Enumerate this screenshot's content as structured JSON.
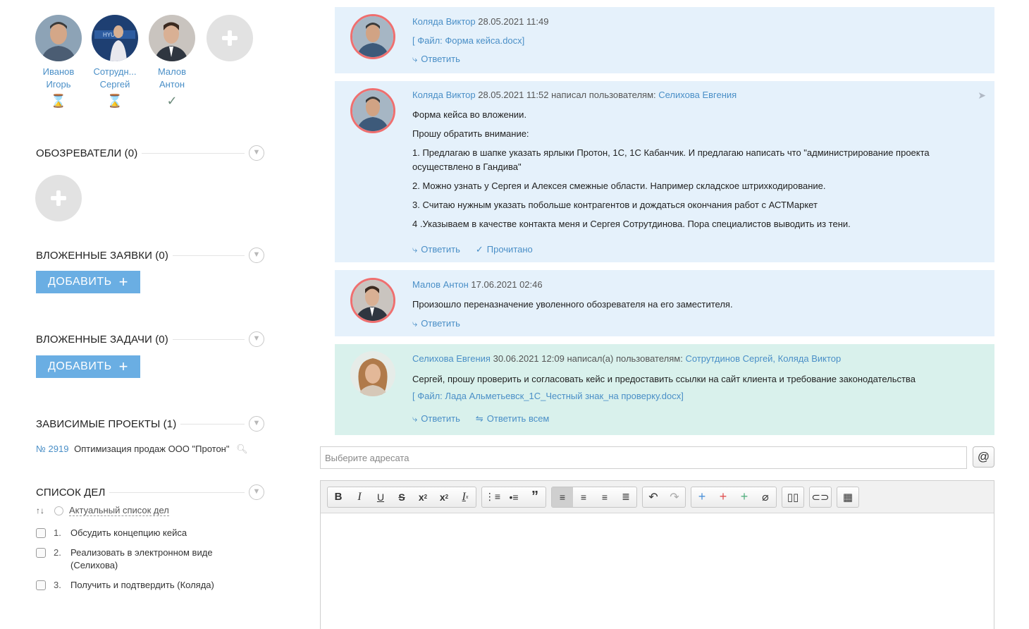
{
  "participants": [
    {
      "name_line1": "Иванов",
      "name_line2": "Игорь",
      "status_icon": "hourglass-icon"
    },
    {
      "name_line1": "Сотрудн...",
      "name_line2": "Сергей",
      "status_icon": "hourglass-icon"
    },
    {
      "name_line1": "Малов",
      "name_line2": "Антон",
      "status_icon": "checkmark-icon"
    }
  ],
  "sections": {
    "reviewers": "ОБОЗРЕВАТЕЛИ (0)",
    "nested_requests": "ВЛОЖЕННЫЕ ЗАЯВКИ (0)",
    "nested_tasks": "ВЛОЖЕННЫЕ ЗАДАЧИ (0)",
    "dependent_projects": "ЗАВИСИМЫЕ ПРОЕКТЫ (1)",
    "todo_list": "СПИСОК ДЕЛ"
  },
  "add_button_label": "ДОБАВИТЬ",
  "dependent_project": {
    "number": "№ 2919",
    "title": "Оптимизация продаж ООО \"Протон\""
  },
  "todo": {
    "sort_icon": "↑↓",
    "current_list_label": "Актуальный список дел",
    "items": [
      {
        "num": "1.",
        "text": "Обсудить концепцию кейса"
      },
      {
        "num": "2.",
        "text": "Реализовать в электронном виде (Селихова)"
      },
      {
        "num": "3.",
        "text": "Получить и подтвердить (Коляда)"
      }
    ]
  },
  "messages": [
    {
      "author": "Коляда Виктор",
      "datetime": "28.05.2021 11:49",
      "attachment": "[ Файл: Форма кейса.docx]",
      "reply": "Ответить"
    },
    {
      "author": "Коляда Виктор",
      "datetime": "28.05.2021 11:52",
      "wrote_to": "написал пользователям:",
      "recipients": "Селихова Евгения",
      "lines": [
        "Форма кейса во вложении.",
        "Прошу обратить внимание:",
        "1. Предлагаю в шапке указать ярлыки Протон, 1С, 1С Кабанчик. И предлагаю написать что \"администрирование проекта осуществлено в Гандива\"",
        "2. Можно узнать у Сергея и Алексея смежные области. Например складское штрихкодирование.",
        "3. Считаю нужным указать побольше контрагентов и дождаться окончания работ с АСТМаркет",
        "4 .Указываем в качестве контакта меня и Сергея  Сотрутдинова. Пора специалистов выводить из тени."
      ],
      "reply": "Ответить",
      "read": "Прочитано"
    },
    {
      "author": "Малов Антон",
      "datetime": "17.06.2021 02:46",
      "text": "Произошло переназначение уволенного обозревателя на его заместителя.",
      "reply": "Ответить"
    },
    {
      "author": "Селихова Евгения",
      "datetime": "30.06.2021 12:09",
      "wrote_to": "написал(а) пользователям:",
      "recipients": "Сотрутдинов Сергей, Коляда Виктор",
      "text": "Сергей, прошу проверить и согласовать кейс и предоставить ссылки на сайт клиента и требование законодательства",
      "attachment": "[ Файл: Лада Альметьевск_1С_Честный знак_на проверку.docx]",
      "reply": "Ответить",
      "reply_all": "Ответить всем"
    }
  ],
  "composer": {
    "recipient_placeholder": "Выберите адресата",
    "at_label": "@"
  },
  "colors": {
    "link": "#4a8fc7",
    "message_bg": "#e5f1fb",
    "message_bg_own": "#d9f1ec",
    "button_bg": "#6aaee3",
    "avatar_ring": "#ef6f6f"
  }
}
